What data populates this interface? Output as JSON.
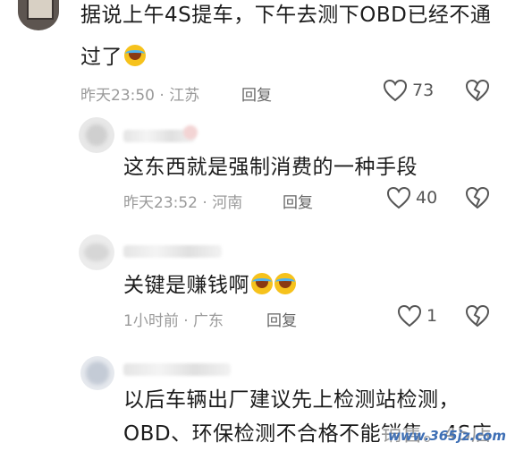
{
  "comments": [
    {
      "text_lines": [
        "据说上午4S提车，下午去测下OBD已经不通",
        "过了"
      ],
      "emoji_count": 1,
      "time": "昨天23:50",
      "sep": "·",
      "location": "江苏",
      "reply_label": "回复",
      "likes": "73"
    },
    {
      "text_lines": [
        "这东西就是强制消费的一种手段"
      ],
      "emoji_count": 0,
      "time": "昨天23:52",
      "sep": "·",
      "location": "河南",
      "reply_label": "回复",
      "likes": "40"
    },
    {
      "text_lines": [
        "关键是赚钱啊"
      ],
      "emoji_count": 2,
      "time": "1小时前",
      "sep": "·",
      "location": "广东",
      "reply_label": "回复",
      "likes": "1"
    },
    {
      "text_lines": [
        "以后车辆出厂建议先上检测站检测，",
        "OBD、环保检测不合格不能销售。4S店"
      ],
      "emoji_count": 0
    }
  ],
  "watermark": "www.365jz.com",
  "colors": {
    "meta": "#9a9a9a",
    "like_stroke": "#555555",
    "emoji": "#f6c21c"
  },
  "icons": [
    "heart-icon",
    "broken-heart-icon",
    "laugh-cry-emoji"
  ]
}
